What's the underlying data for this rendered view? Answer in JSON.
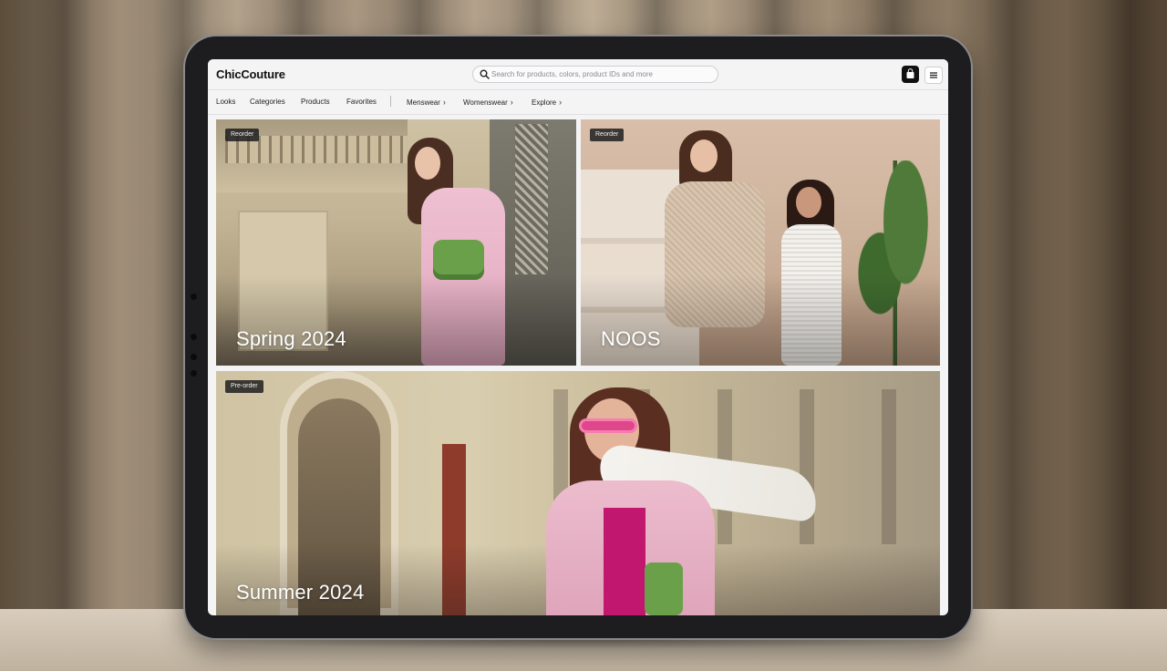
{
  "app": {
    "brand": "ChicCouture"
  },
  "search": {
    "placeholder": "Search for products, colors, product IDs and more"
  },
  "header": {
    "bag_icon": "shopping-bag-icon",
    "menu_icon": "hamburger-menu-icon"
  },
  "nav": {
    "primary": [
      "Looks",
      "Categories",
      "Products",
      "Favorites"
    ],
    "secondary": [
      {
        "label": "Menswear",
        "icon": "chevron-right-icon"
      },
      {
        "label": "Womenswear",
        "icon": "chevron-right-icon"
      },
      {
        "label": "Explore",
        "icon": "chevron-right-icon"
      }
    ]
  },
  "collections": [
    {
      "title": "Spring 2024",
      "badge": "Reorder"
    },
    {
      "title": "NOOS",
      "badge": "Reorder"
    },
    {
      "title": "Summer 2024",
      "badge": "Pre-order"
    }
  ],
  "colors": {
    "accent_dark": "#111111",
    "badge_bg": "#1e1e1e",
    "pink_blazer": "#e8b2c6",
    "bag_green": "#6aa04a"
  }
}
